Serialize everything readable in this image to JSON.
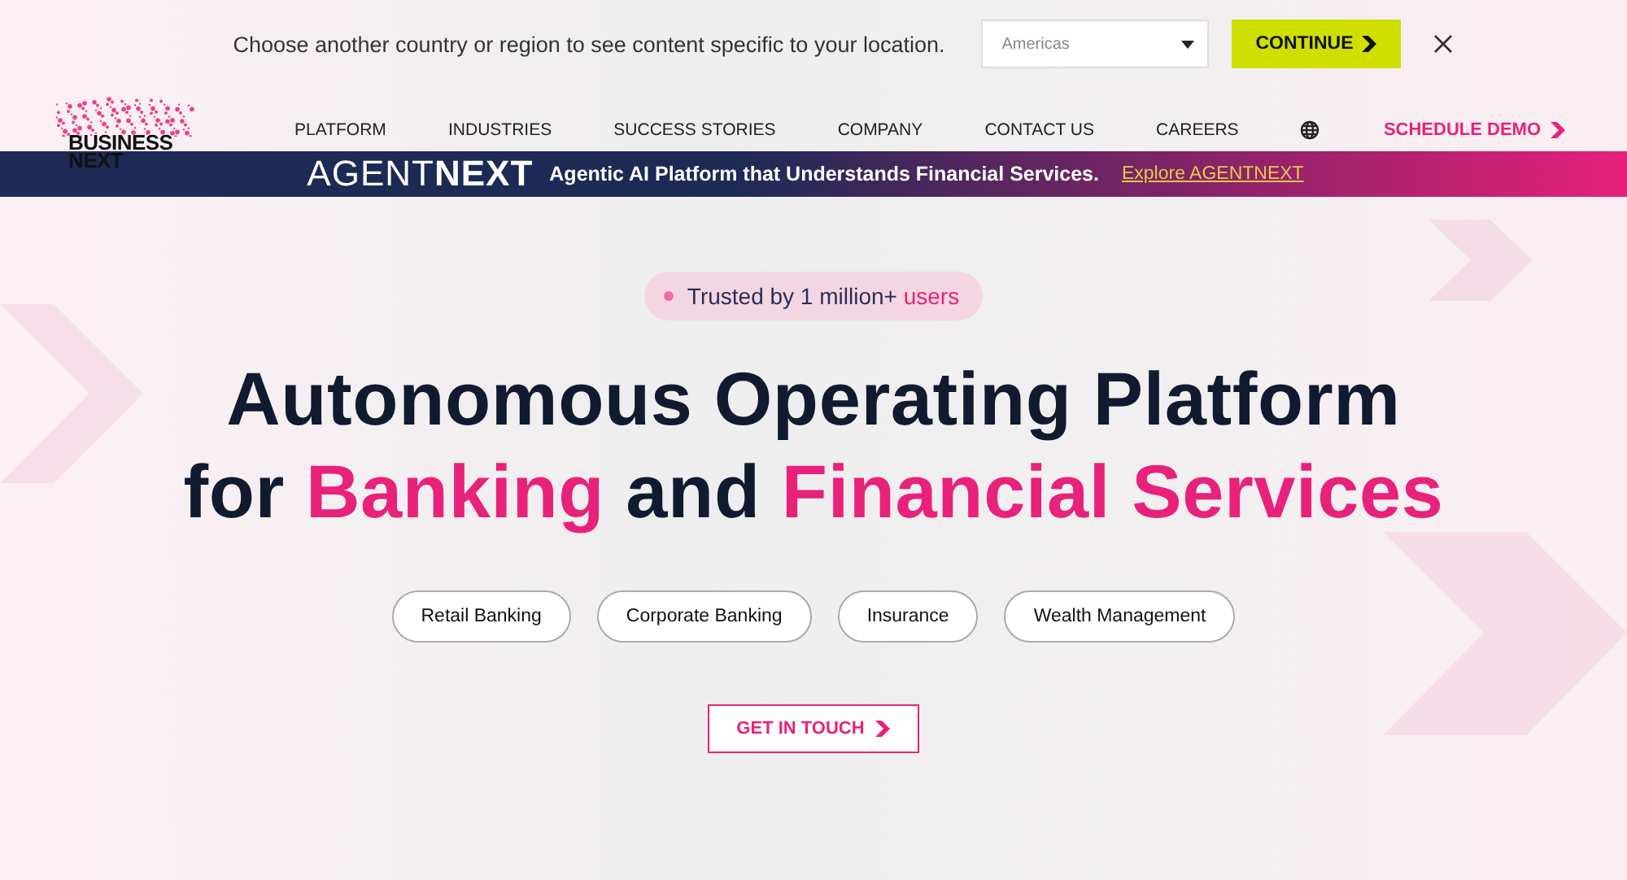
{
  "region_bar": {
    "message": "Choose another country or region to see content specific to your location.",
    "region_select": {
      "value": "Americas"
    },
    "continue_button": "CONTINUE"
  },
  "nav": {
    "logo": {
      "line_1": "BUSINESS",
      "line_2": "NEXT"
    },
    "items": [
      {
        "label": "PLATFORM"
      },
      {
        "label": "INDUSTRIES"
      },
      {
        "label": "SUCCESS STORIES"
      },
      {
        "label": "COMPANY"
      },
      {
        "label": "CONTACT US"
      },
      {
        "label": "CAREERS"
      }
    ],
    "cta": "SCHEDULE DEMO"
  },
  "banner": {
    "logo": {
      "light": "AGENT",
      "bold": "NEXT"
    },
    "text": "Agentic AI Platform that Understands Financial Services.",
    "link": "Explore AGENTNEXT"
  },
  "hero": {
    "badge": [
      {
        "text": "Trusted by 1 million+ ",
        "accent": false
      },
      {
        "text": "users",
        "accent": true
      }
    ],
    "headline": [
      [
        {
          "text": "Autonomous Operating Platform",
          "accent": false
        }
      ],
      [
        {
          "text": "for ",
          "accent": false
        },
        {
          "text": "Banking",
          "accent": true
        },
        {
          "text": " and ",
          "accent": false
        },
        {
          "text": "Financial Services",
          "accent": true
        }
      ]
    ],
    "chips": [
      "Retail Banking",
      "Corporate Banking",
      "Insurance",
      "Wealth Management"
    ],
    "cta": "GET IN TOUCH"
  }
}
